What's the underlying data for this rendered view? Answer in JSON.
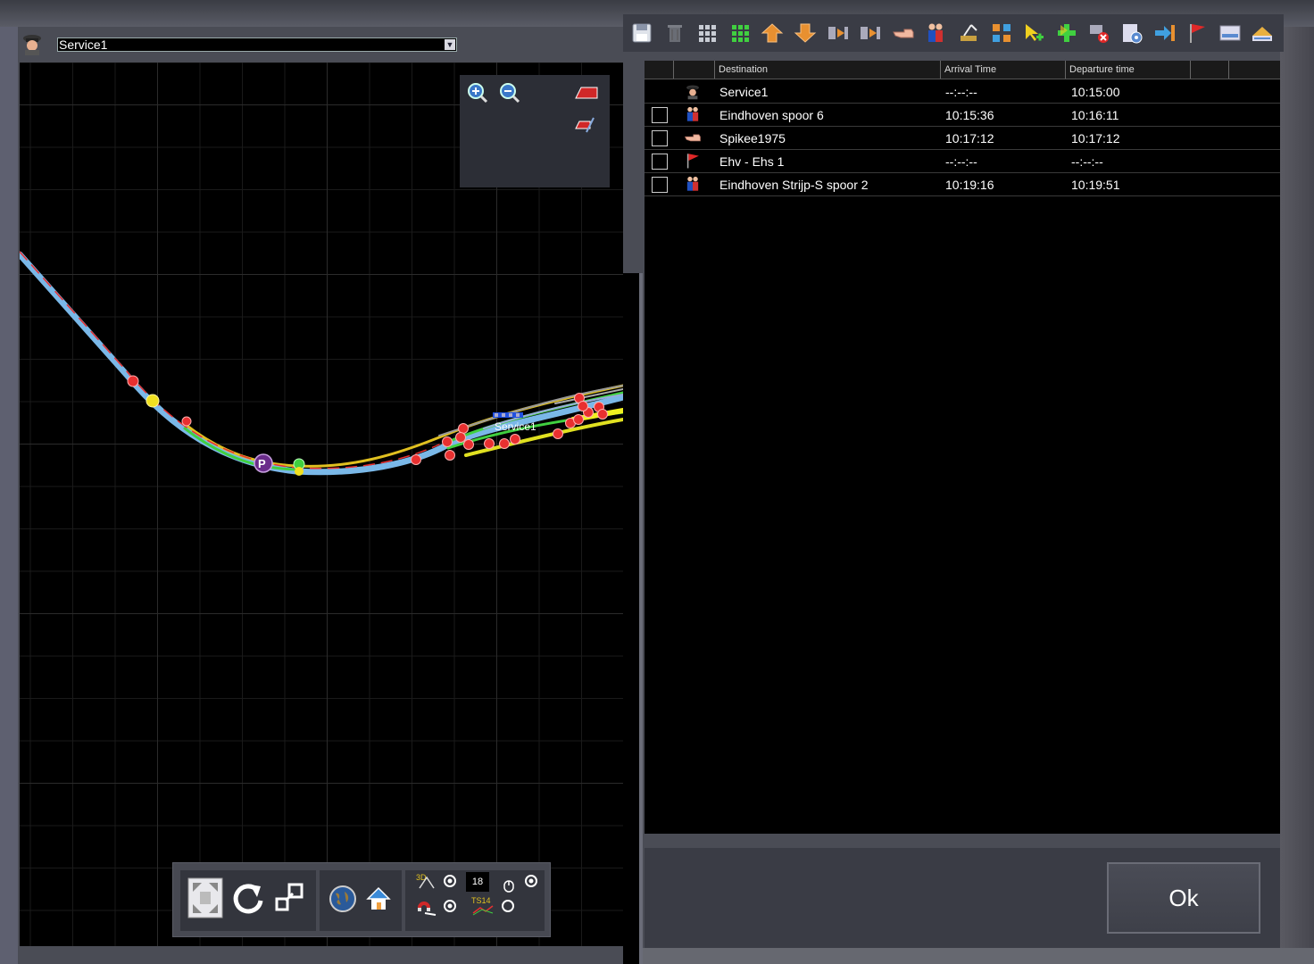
{
  "service_selector": {
    "selected": "Service1",
    "icon": "conductor-icon"
  },
  "toolbar": {
    "buttons": [
      {
        "name": "save-icon"
      },
      {
        "name": "trash-icon"
      },
      {
        "name": "grid-gray-icon"
      },
      {
        "name": "grid-green-icon"
      },
      {
        "name": "move-up-icon"
      },
      {
        "name": "move-down-icon"
      },
      {
        "name": "insert-before-icon"
      },
      {
        "name": "insert-after-icon"
      },
      {
        "name": "hand-pointer-icon"
      },
      {
        "name": "passengers-icon"
      },
      {
        "name": "crane-icon"
      },
      {
        "name": "coupling-icon"
      },
      {
        "name": "add-cursor-icon"
      },
      {
        "name": "add-cross-icon"
      },
      {
        "name": "remove-consist-icon"
      },
      {
        "name": "settings-icon"
      },
      {
        "name": "enter-icon"
      },
      {
        "name": "flag-icon"
      },
      {
        "name": "panel-icon"
      },
      {
        "name": "platform-icon"
      }
    ]
  },
  "table": {
    "headers": {
      "destination": "Destination",
      "arrival": "Arrival Time",
      "departure": "Departure time"
    },
    "rows": [
      {
        "icon": "conductor-icon",
        "checkbox": false,
        "destination": "Service1",
        "arrival": "--:--:--",
        "departure": "10:15:00"
      },
      {
        "icon": "passengers-icon",
        "checkbox": true,
        "destination": "Eindhoven spoor 6",
        "arrival": "10:15:36",
        "departure": "10:16:11"
      },
      {
        "icon": "hand-pointer-icon",
        "checkbox": true,
        "destination": "Spikee1975",
        "arrival": "10:17:12",
        "departure": "10:17:12"
      },
      {
        "icon": "flag-icon",
        "checkbox": true,
        "destination": "Ehv - Ehs 1",
        "arrival": "--:--:--",
        "departure": "--:--:--"
      },
      {
        "icon": "passengers-icon",
        "checkbox": true,
        "destination": "Eindhoven Strijp-S spoor 2",
        "arrival": "10:19:16",
        "departure": "10:19:51"
      }
    ]
  },
  "map": {
    "train_label": "Service1",
    "platform_marker": "P"
  },
  "map_toolbar": {
    "counter": "18",
    "label_3d": "3D",
    "label_ts": "TS14"
  },
  "footer": {
    "ok_label": "Ok"
  },
  "colors": {
    "accent_green": "#40d040",
    "track_blue": "#7ab8e8",
    "marker_red": "#e83030",
    "marker_yellow": "#f0e020"
  }
}
